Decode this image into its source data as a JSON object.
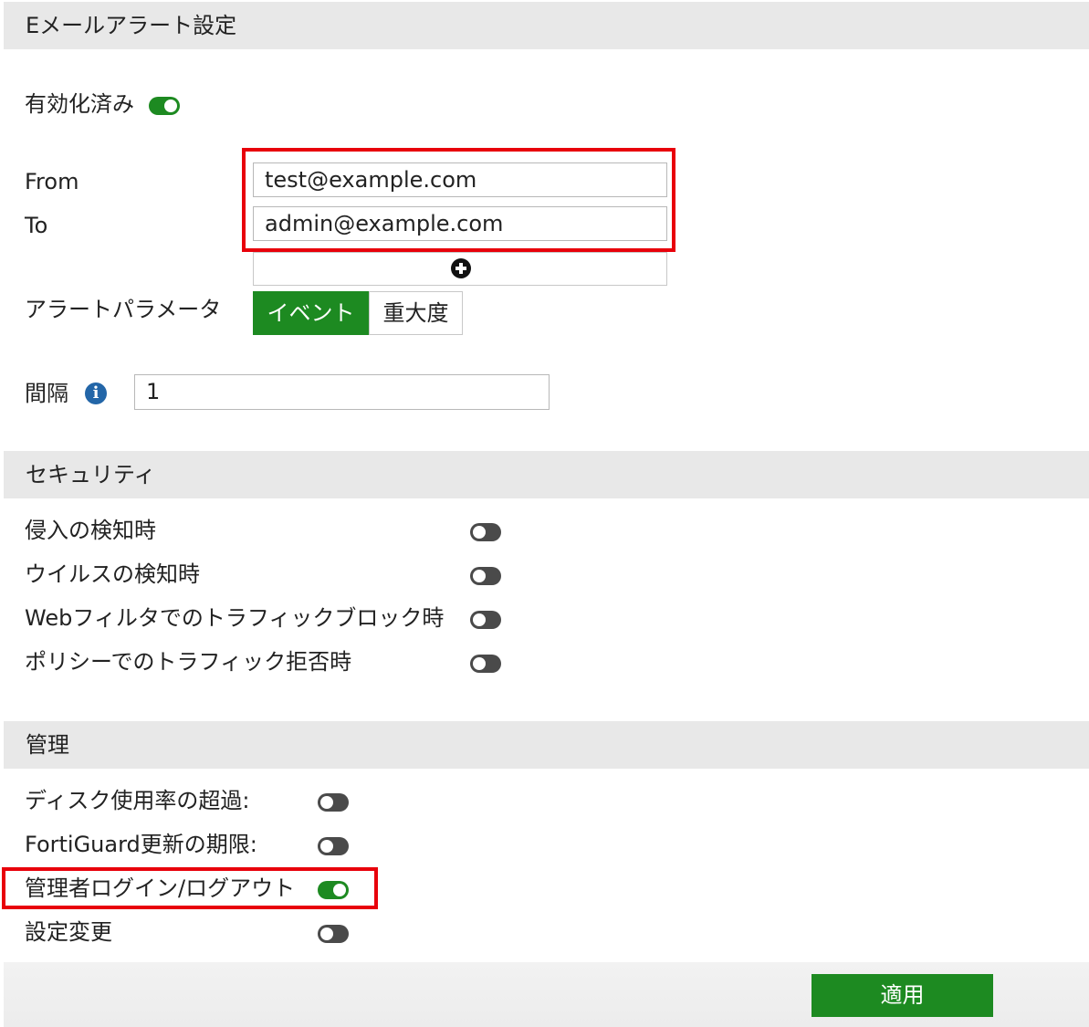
{
  "header": {
    "title": "Eメールアラート設定"
  },
  "enabled": {
    "label": "有効化済み",
    "state": "on"
  },
  "from": {
    "label": "From",
    "value": "test@example.com"
  },
  "to": {
    "label": "To",
    "value": "admin@example.com"
  },
  "add_recipient_icon": "plus-circle-icon",
  "alert_parameter": {
    "label": "アラートパラメータ",
    "options": [
      "イベント",
      "重大度"
    ],
    "selected": "イベント"
  },
  "interval": {
    "label": "間隔",
    "value": "1",
    "info_icon": "info-icon",
    "info_glyph": "i"
  },
  "security": {
    "title": "セキュリティ",
    "items": [
      {
        "label": "侵入の検知時",
        "state": "off"
      },
      {
        "label": "ウイルスの検知時",
        "state": "off"
      },
      {
        "label": "Webフィルタでのトラフィックブロック時",
        "state": "off"
      },
      {
        "label": "ポリシーでのトラフィック拒否時",
        "state": "off"
      }
    ]
  },
  "management": {
    "title": "管理",
    "items": [
      {
        "label": "ディスク使用率の超過:",
        "state": "off"
      },
      {
        "label": "FortiGuard更新の期限:",
        "state": "off"
      },
      {
        "label": "管理者ログイン/ログアウト",
        "state": "on"
      },
      {
        "label": "設定変更",
        "state": "off"
      }
    ]
  },
  "apply_button": {
    "label": "適用"
  },
  "colors": {
    "accent_green": "#1d8a21",
    "highlight_red": "#e8000b",
    "section_bg": "#e8e8e8",
    "toggle_off": "#4a4a4a",
    "info_blue": "#2366a8"
  }
}
